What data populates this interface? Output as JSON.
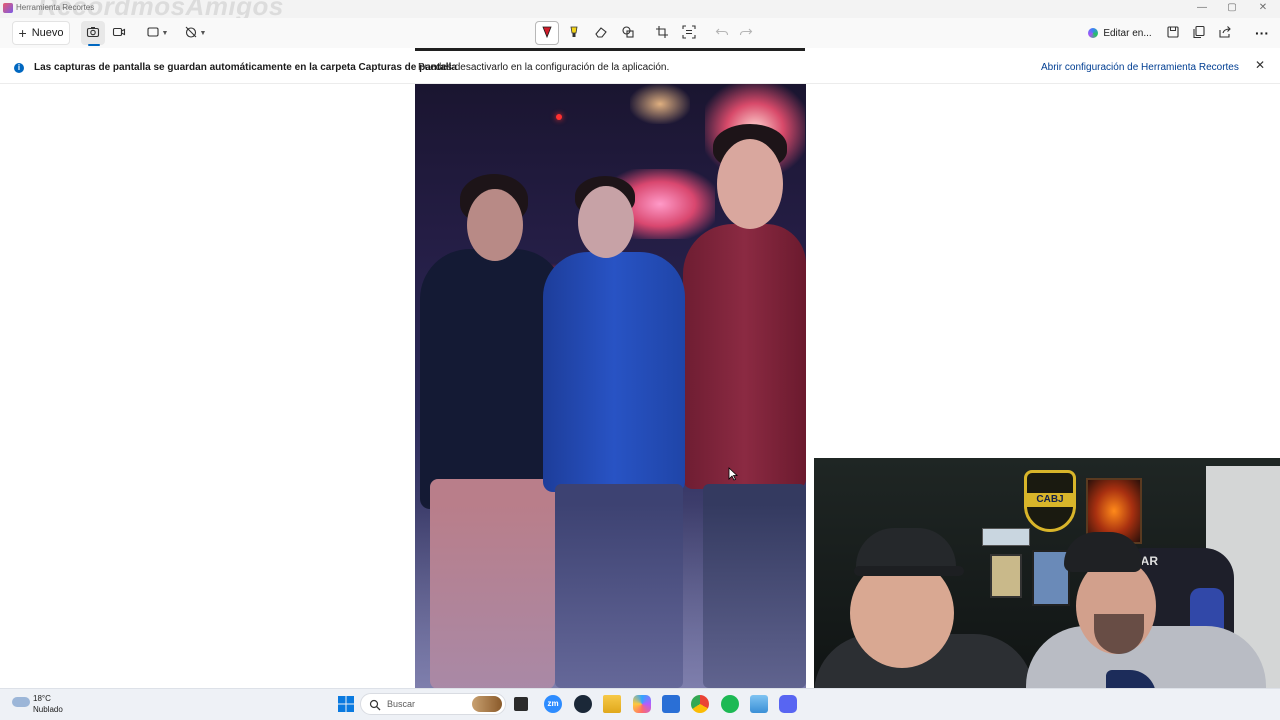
{
  "window": {
    "app_title": "Herramienta Recortes",
    "watermark": "RecordmosAmigos",
    "controls": [
      "—",
      "▢",
      "✕"
    ]
  },
  "toolbar": {
    "new_label": "Nuevo",
    "edit_in_label": "Editar en...",
    "tools": [
      "camera-icon",
      "video-icon",
      "rectangle-mode-icon",
      "delay-icon",
      "pen-icon",
      "highlighter-icon",
      "eraser-icon",
      "shapes-icon",
      "crop-icon",
      "text-actions-icon",
      "undo-icon",
      "redo-icon",
      "save-icon",
      "copy-icon",
      "share-icon",
      "more-icon"
    ],
    "accent_color": "#0067c0"
  },
  "infobar": {
    "title": "Las capturas de pantalla se guardan automáticamente en la carpeta Capturas de pantalla",
    "message": "Puedes desactivarlo en la configuración de la aplicación.",
    "link": "Abrir configuración de Herramienta Recortes",
    "close": "✕"
  },
  "webcam": {
    "badge": "CABJ",
    "chair_text": "DAR"
  },
  "taskbar": {
    "weather_temp": "18°C",
    "weather_desc": "Nublado",
    "search_placeholder": "Buscar",
    "apps": [
      "windows-start-icon",
      "file-explorer-icon",
      "zoom-icon",
      "steam-icon",
      "folder-icon",
      "copilot-icon",
      "store-icon",
      "chrome-icon",
      "spotify-icon",
      "photos-icon",
      "discord-icon"
    ]
  }
}
